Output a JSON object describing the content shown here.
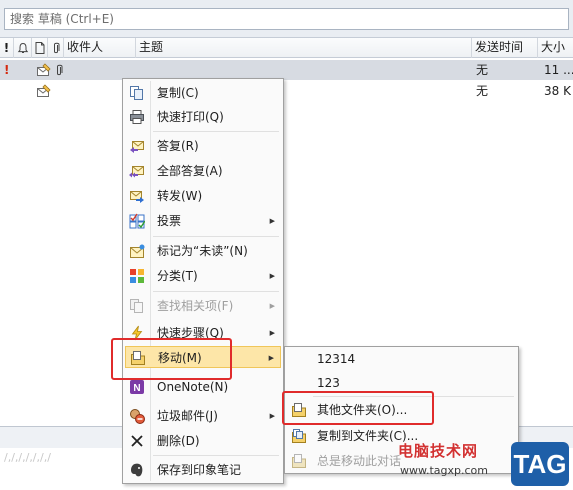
{
  "search": {
    "placeholder": "搜索 草稿 (Ctrl+E)"
  },
  "columns": {
    "importance": "!",
    "recipient": "收件人",
    "subject": "主题",
    "sent": "发送时间",
    "size": "大小"
  },
  "messages": [
    {
      "sent": "无",
      "size": "11 ...",
      "flag": "!"
    },
    {
      "sent": "无",
      "size": "38 K"
    }
  ],
  "lower_pane": {
    "faint_text": "/,/,/,/,/,/,/"
  },
  "context_menu": {
    "items": [
      {
        "label": "复制(C)",
        "icon": "copy-icon"
      },
      {
        "label": "快速打印(Q)",
        "icon": "print-icon"
      },
      {
        "label": "答复(R)",
        "icon": "reply-icon"
      },
      {
        "label": "全部答复(A)",
        "icon": "reply-all-icon"
      },
      {
        "label": "转发(W)",
        "icon": "forward-icon"
      },
      {
        "label": "投票",
        "icon": "vote-icon"
      },
      {
        "label": "标记为“未读”(N)",
        "icon": "mark-unread-icon"
      },
      {
        "label": "分类(T)",
        "icon": "categorize-icon"
      },
      {
        "label": "查找相关项(F)",
        "icon": "find-related-icon"
      },
      {
        "label": "快速步骤(Q)",
        "icon": "quick-steps-icon"
      },
      {
        "label": "移动(M)",
        "icon": "move-icon"
      },
      {
        "label": "OneNote(N)",
        "icon": "onenote-icon"
      },
      {
        "label": "垃圾邮件(J)",
        "icon": "junk-icon"
      },
      {
        "label": "删除(D)",
        "icon": "delete-icon"
      },
      {
        "label": "保存到印象笔记",
        "icon": "evernote-icon"
      }
    ]
  },
  "submenu": {
    "items": [
      {
        "label": "12314"
      },
      {
        "label": "123"
      },
      {
        "label": "其他文件夹(O)...",
        "icon": "move-folder-icon"
      },
      {
        "label": "复制到文件夹(C)...",
        "icon": "copy-folder-icon"
      },
      {
        "label": "总是移动此对话",
        "icon": "always-move-icon"
      }
    ]
  },
  "colors": {
    "highlight": "#fde6a8",
    "annotation": "#e02b2b"
  },
  "watermark": {
    "title": "电脑技术网",
    "url": "www.tagxp.com",
    "tag": "TAG"
  }
}
